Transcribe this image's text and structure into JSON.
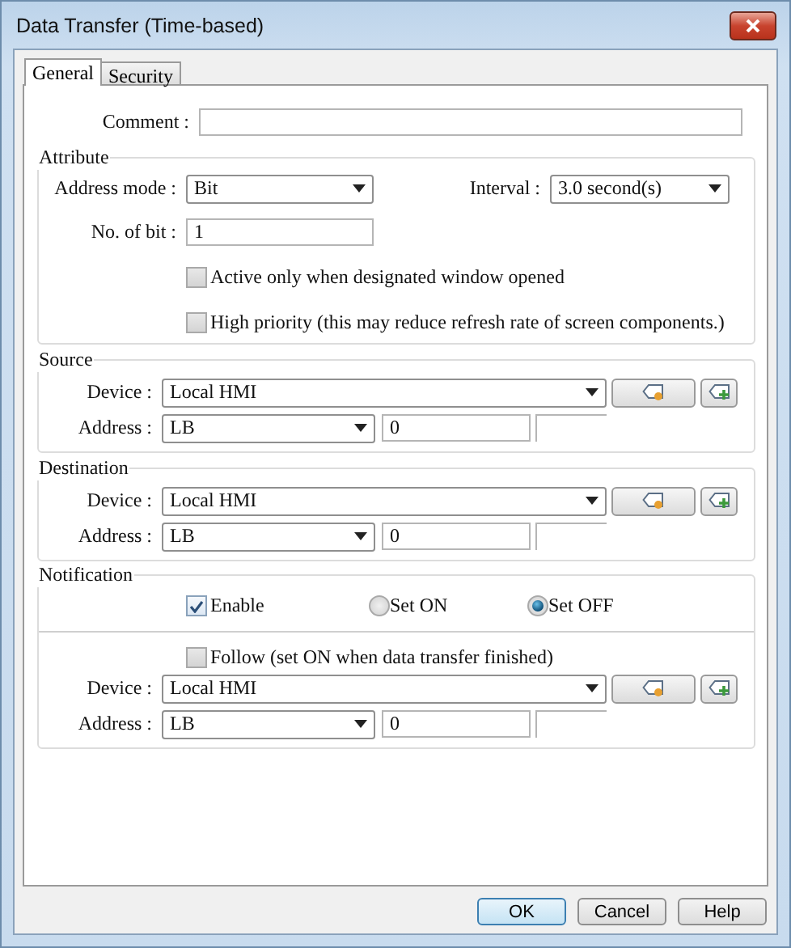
{
  "window": {
    "title": "Data Transfer (Time-based)"
  },
  "tabs": [
    {
      "label": "General",
      "selected": true
    },
    {
      "label": "Security",
      "selected": false
    }
  ],
  "comment": {
    "label": "Comment :"
  },
  "attribute": {
    "title": "Attribute",
    "address_mode": {
      "label": "Address mode :",
      "value": "Bit"
    },
    "interval": {
      "label": "Interval :",
      "value": "3.0 second(s)"
    },
    "no_of_bit": {
      "label": "No. of bit :",
      "value": "1"
    },
    "options": [
      {
        "label": "Active only when designated window opened",
        "checked": false
      },
      {
        "label": "High priority (this may reduce refresh rate of screen components.)",
        "checked": false
      }
    ]
  },
  "source": {
    "title": "Source",
    "device": {
      "label": "Device :",
      "value": "Local HMI"
    },
    "address": {
      "label": "Address :",
      "type": "LB",
      "value": "0"
    }
  },
  "destination": {
    "title": "Destination",
    "device": {
      "label": "Device :",
      "value": "Local HMI"
    },
    "address": {
      "label": "Address :",
      "type": "LB",
      "value": "0"
    }
  },
  "notification": {
    "title": "Notification",
    "enable": {
      "label": "Enable",
      "checked": true
    },
    "modes": [
      {
        "label": "Set ON",
        "selected": false
      },
      {
        "label": "Set OFF",
        "selected": true
      }
    ],
    "follow": {
      "label": "Follow (set ON when data transfer finished)",
      "checked": false
    },
    "device": {
      "label": "Device :",
      "value": "Local HMI"
    },
    "address": {
      "label": "Address :",
      "type": "LB",
      "value": "0"
    }
  },
  "buttons": [
    {
      "label": "OK",
      "default": true
    },
    {
      "label": "Cancel",
      "default": false
    },
    {
      "label": "Help",
      "default": false
    }
  ]
}
